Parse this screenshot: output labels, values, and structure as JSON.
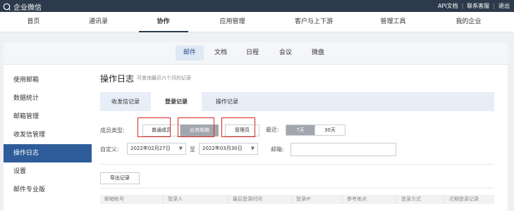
{
  "topbar": {
    "logo_text": "企业微信",
    "links": [
      "API文档",
      "联系客服",
      "退出"
    ]
  },
  "main_nav": {
    "items": [
      "首页",
      "通讯录",
      "协作",
      "应用管理",
      "客户与上下游",
      "管理工具",
      "我的企业"
    ],
    "active": "协作"
  },
  "sub_nav": {
    "items": [
      "邮件",
      "文档",
      "日程",
      "会议",
      "微盘"
    ],
    "active": "邮件"
  },
  "sidebar": {
    "items": [
      "使用邮箱",
      "数据统计",
      "邮箱管理",
      "收发信管理",
      "操作日志",
      "设置",
      "邮件专业版"
    ],
    "active": "操作日志"
  },
  "page": {
    "title": "操作日志",
    "subtitle": "可查询最近六个月的记录"
  },
  "tabs": {
    "items": [
      "收发信记录",
      "登录记录",
      "操作记录"
    ],
    "active": "登录记录"
  },
  "filters": {
    "member_type_label": "成员类型:",
    "member_types": [
      "普通成员",
      "业务邮箱",
      "管理员"
    ],
    "recent_label": "最近:",
    "recent_options": [
      "7天",
      "30天"
    ],
    "custom_label": "自定义:",
    "start_date": "2022年02月27日",
    "to_label": "至",
    "end_date": "2022年03月30日",
    "mailbox_label": "邮箱:",
    "mailbox_value": ""
  },
  "export_label": "导出记录",
  "table": {
    "headers": [
      "邮箱帐号",
      "登录人",
      "最后登录时间",
      "登录IP",
      "参考地点",
      "登录方式",
      "近期登录记录"
    ]
  },
  "colors": {
    "topbar": "#2d3a4b",
    "active": "#2d5c99",
    "highlight": "#d9281f"
  }
}
